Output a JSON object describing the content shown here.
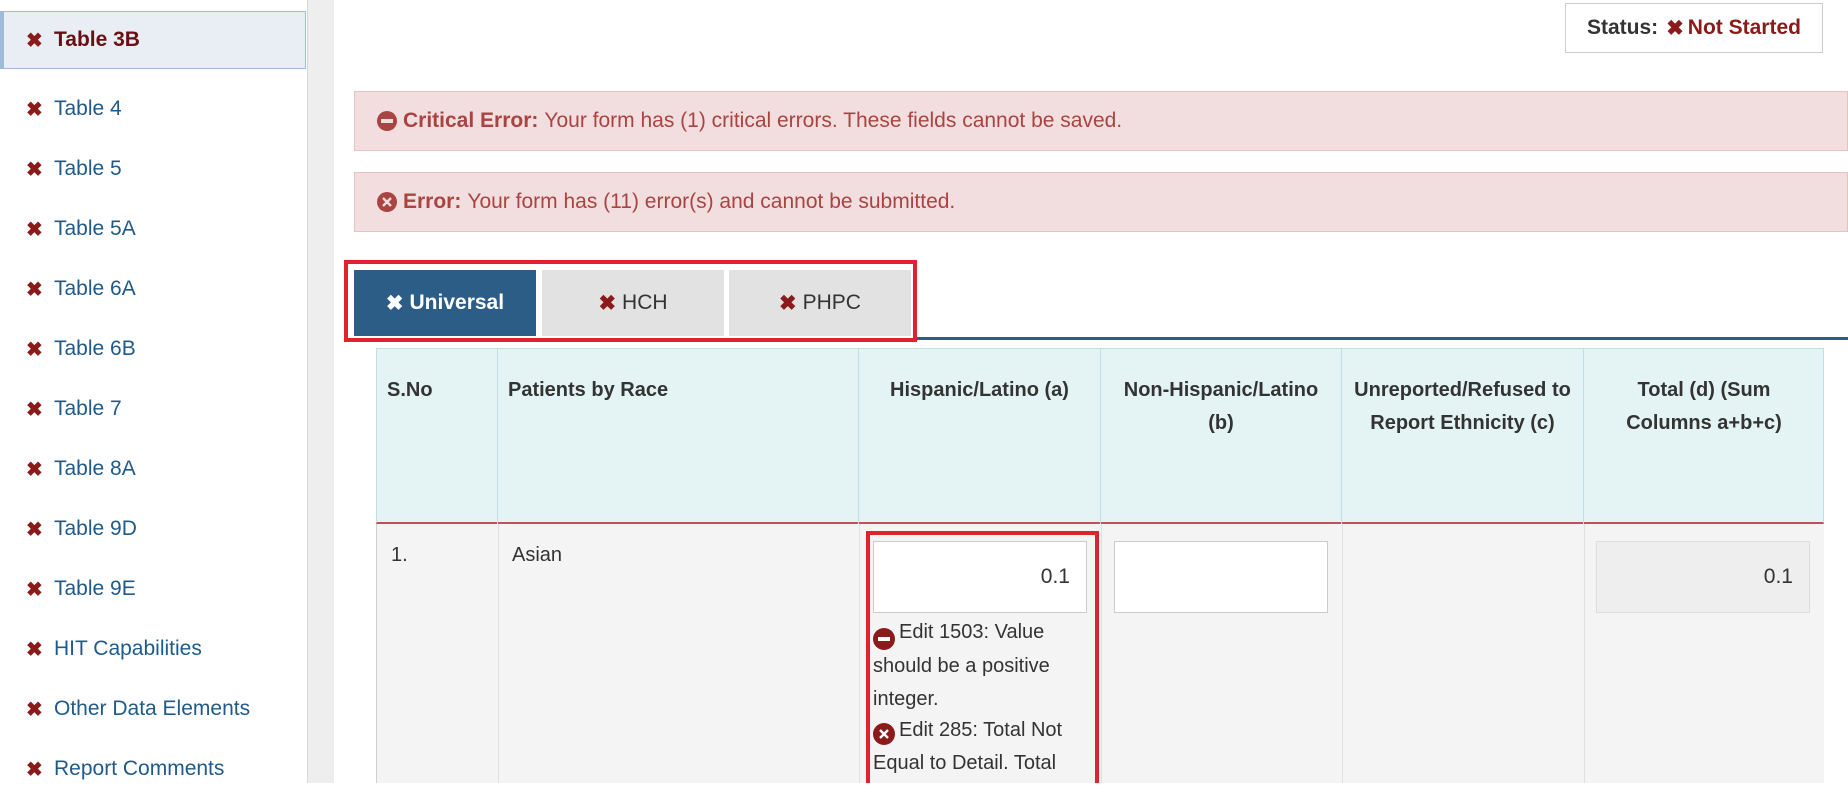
{
  "sidebar": {
    "items": [
      {
        "label": "Table 3B",
        "active": true
      },
      {
        "label": "Table 4"
      },
      {
        "label": "Table 5"
      },
      {
        "label": "Table 5A"
      },
      {
        "label": "Table 6A"
      },
      {
        "label": "Table 6B"
      },
      {
        "label": "Table 7"
      },
      {
        "label": "Table 8A"
      },
      {
        "label": "Table 9D"
      },
      {
        "label": "Table 9E"
      },
      {
        "label": "HIT Capabilities"
      },
      {
        "label": "Other Data Elements"
      },
      {
        "label": "Report Comments"
      }
    ],
    "item_icon": "✖"
  },
  "status": {
    "label": "Status:",
    "icon": "✖",
    "value": "Not Started"
  },
  "alerts": {
    "critical": {
      "icon": "minus-circle-icon",
      "label": "Critical Error:",
      "message": "Your form has (1) critical errors. These fields cannot be saved."
    },
    "error": {
      "icon": "x-circle-icon",
      "label": "Error:",
      "message": "Your form has (11) error(s) and cannot be submitted."
    }
  },
  "tabs": [
    {
      "label": "Universal",
      "icon": "✖",
      "active": true
    },
    {
      "label": "HCH",
      "icon": "✖"
    },
    {
      "label": "PHPC",
      "icon": "✖"
    }
  ],
  "table": {
    "headers": {
      "sno": "S.No",
      "race": "Patients by Race",
      "a": "Hispanic/Latino (a)",
      "b": "Non-Hispanic/Latino (b)",
      "c": "Unreported/Refused to Report Ethnicity (c)",
      "d": "Total (d) (Sum Columns a+b+c)"
    },
    "rows": [
      {
        "sno": "1.",
        "race": "Asian",
        "a_value": "0.1",
        "b_value": "",
        "d_value": "0.1",
        "edits": [
          {
            "icon": "minus-circle-icon",
            "text": "Edit 1503: Value should be a positive integer."
          },
          {
            "icon": "x-circle-icon",
            "text": "Edit 285: Total Not Equal to Detail. Total"
          }
        ]
      }
    ]
  },
  "colors": {
    "accent_blue": "#2c5d86",
    "error_red": "#8b1a1a",
    "alert_bg": "#f2dede",
    "highlight_outline": "#e0222e",
    "header_bg": "#e4f4f4"
  }
}
